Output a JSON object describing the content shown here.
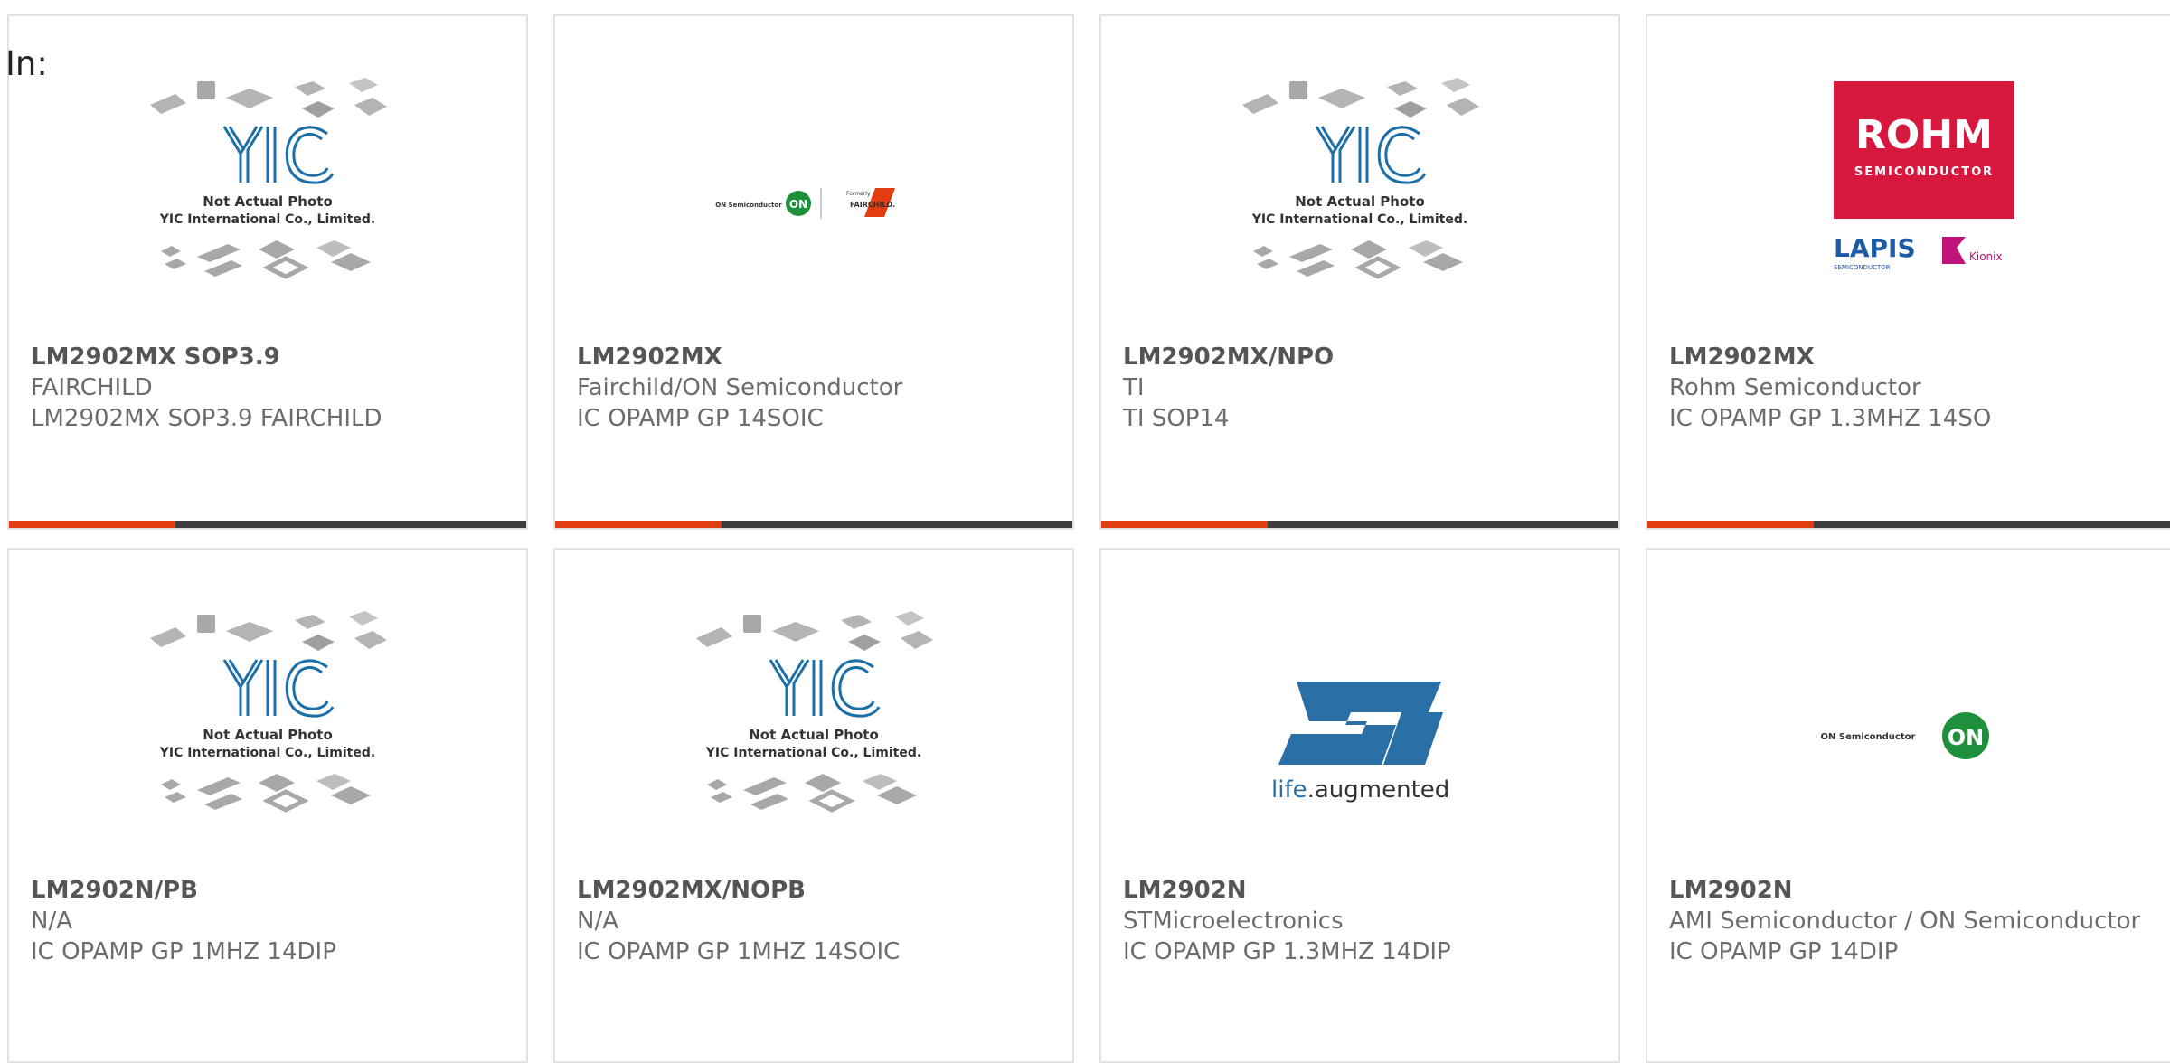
{
  "page": {
    "prefix_label": "In:"
  },
  "colors": {
    "accent": "#e13d12",
    "bar": "#3d3d3d",
    "border": "#e2e2e2",
    "text": "#6c6c6c",
    "yic_blue": "#1d6fa7",
    "rohm_red": "#d7173d",
    "st_blue": "#2a6fa5",
    "on_green": "#1e8f3a"
  },
  "products": [
    {
      "part": "LM2902MX SOP3.9",
      "manufacturer": "FAIRCHILD",
      "description": "LM2902MX SOP3.9 FAIRCHILD",
      "image": "yic-placeholder",
      "has_bar": true
    },
    {
      "part": "LM2902MX",
      "manufacturer": "Fairchild/ON Semiconductor",
      "description": "IC OPAMP GP 14SOIC",
      "image": "on-fairchild-logo",
      "has_bar": true
    },
    {
      "part": "LM2902MX/NPO",
      "manufacturer": "TI",
      "description": "TI SOP14",
      "image": "yic-placeholder",
      "has_bar": true
    },
    {
      "part": "LM2902MX",
      "manufacturer": "Rohm Semiconductor",
      "description": "IC OPAMP GP 1.3MHZ 14SO",
      "image": "rohm-logo",
      "has_bar": true
    },
    {
      "part": "LM2902N/PB",
      "manufacturer": "N/A",
      "description": "IC OPAMP GP 1MHZ 14DIP",
      "image": "yic-placeholder",
      "has_bar": false
    },
    {
      "part": "LM2902MX/NOPB",
      "manufacturer": "N/A",
      "description": "IC OPAMP GP 1MHZ 14SOIC",
      "image": "yic-placeholder",
      "has_bar": false
    },
    {
      "part": "LM2902N",
      "manufacturer": "STMicroelectronics",
      "description": "IC OPAMP GP 1.3MHZ 14DIP",
      "image": "st-logo",
      "has_bar": false
    },
    {
      "part": "LM2902N",
      "manufacturer": "AMI Semiconductor / ON Semiconductor",
      "description": "IC OPAMP GP 14DIP",
      "image": "on-semi-logo",
      "has_bar": false
    }
  ],
  "logos": {
    "yic_line1": "Not Actual Photo",
    "yic_line2": "YIC International Co., Limited.",
    "rohm_name": "ROHM",
    "rohm_sub": "SEMICONDUCTOR",
    "lapis": "LAPIS",
    "lapis_sub": "SEMICONDUCTOR",
    "kionix": "Kionix",
    "st_tagline_1": "life",
    "st_tagline_2": ".augmented",
    "on_text": "ON Semiconductor",
    "on_badge": "ON",
    "fairchild_small": "Formerly",
    "fairchild": "FAIRCHILD."
  }
}
